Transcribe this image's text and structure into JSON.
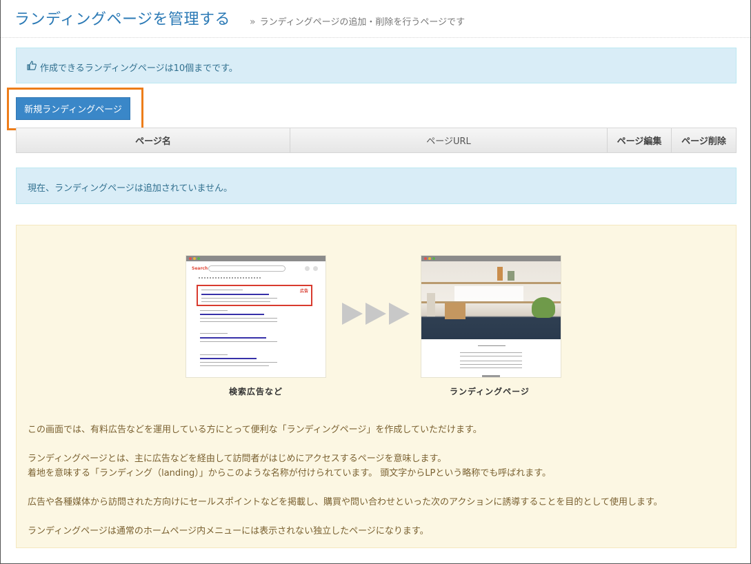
{
  "header": {
    "title": "ランディングページを管理する",
    "subtitle_sep": "»",
    "subtitle": "ランディングページの追加・削除を行うページです"
  },
  "info": {
    "icon": "hand-pointing-icon",
    "text": "作成できるランディングページは10個までです。"
  },
  "toolbar": {
    "new_label": "新規ランディングページ"
  },
  "table": {
    "columns": [
      "ページ名",
      "ページURL",
      "ページ編集",
      "ページ削除"
    ]
  },
  "empty_message": "現在、ランディングページは追加されていません。",
  "explain": {
    "illustrations": {
      "left_caption": "検索広告など",
      "search_logo": "Search",
      "ad_badge": "広告",
      "right_caption": "ランディングページ"
    },
    "paragraphs": [
      "この画面では、有料広告などを運用している方にとって便利な「ランディングページ」を作成していただけます。",
      "ランディングページとは、主に広告などを経由して訪問者がはじめにアクセスするページを意味します。",
      "着地を意味する「ランディング（landing）」からこのような名称が付けられています。 頭文字からLPという略称でも呼ばれます。",
      "広告や各種媒体から訪問された方向けにセールスポイントなどを掲載し、購買や問い合わせといった次のアクションに誘導することを目的として使用します。",
      "ランディングページは通常のホームページ内メニューには表示されない独立したページになります。"
    ]
  },
  "colors": {
    "title": "#2a79b5",
    "button": "#3a87c8",
    "info_bg": "#d9edf7",
    "explain_bg": "#fcf7e3",
    "highlight": "#ed7d1a"
  }
}
